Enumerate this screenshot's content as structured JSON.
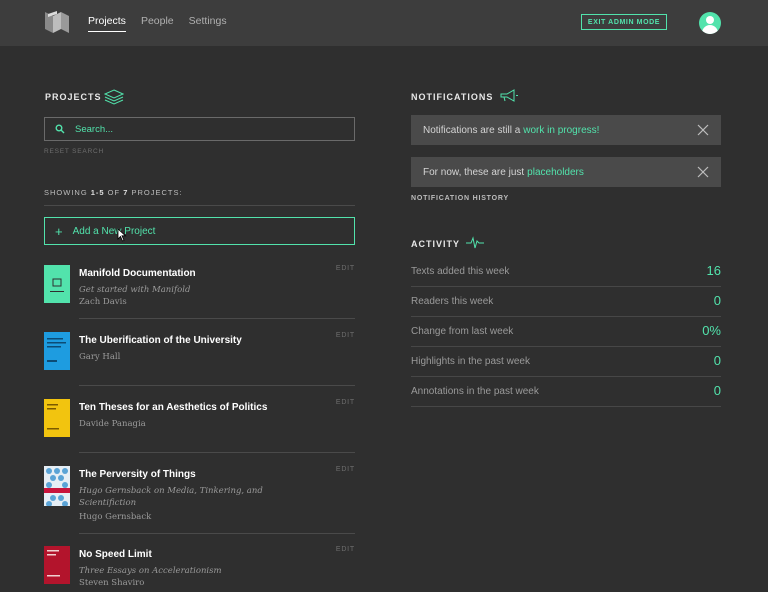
{
  "nav": {
    "items": [
      {
        "label": "Projects",
        "active": true
      },
      {
        "label": "People"
      },
      {
        "label": "Settings"
      }
    ]
  },
  "header": {
    "exit_label": "EXIT ADMIN MODE",
    "avatar_icon": "user-avatar-icon",
    "accent": "#52e3ac"
  },
  "projects": {
    "heading": "PROJECTS",
    "search_placeholder": "Search...",
    "reset_label": "RESET SEARCH",
    "showing_prefix": "SHOWING ",
    "showing_range": "1-5",
    "showing_of": " OF ",
    "showing_total": "7",
    "showing_suffix": " PROJECTS:",
    "add_label": "Add a New Project",
    "edit_label": "EDIT",
    "items": [
      {
        "title": "Manifold Documentation",
        "subtitle": "Get started with Manifold",
        "author": "Zach Davis",
        "cover_color": "#52e3ac"
      },
      {
        "title": "The Uberification of the University",
        "subtitle": "",
        "author": "Gary Hall",
        "cover_color": "#1e9ce0"
      },
      {
        "title": "Ten Theses for an Aesthetics of Politics",
        "subtitle": "",
        "author": "Davide Panagia",
        "cover_color": "#f2c40f"
      },
      {
        "title": "The Perversity of Things",
        "subtitle": "Hugo Gernsback on Media, Tinkering, and Scientifiction",
        "author": "Hugo Gernsback",
        "cover_color": "#e6eef5"
      },
      {
        "title": "No Speed Limit",
        "subtitle": "Three Essays on Accelerationism",
        "author": "Steven Shaviro",
        "cover_color": "#b3142c"
      }
    ]
  },
  "notifications": {
    "heading": "NOTIFICATIONS",
    "items": [
      {
        "text": "Notifications are still a",
        "highlight": "work in progress!"
      },
      {
        "text": "For now, these are just",
        "highlight": "placeholders"
      }
    ],
    "history_label": "NOTIFICATION HISTORY"
  },
  "activity": {
    "heading": "ACTIVITY",
    "rows": [
      {
        "label": "Texts added this week",
        "value": "16"
      },
      {
        "label": "Readers this week",
        "value": "0"
      },
      {
        "label": "Change from last week",
        "value": "0%"
      },
      {
        "label": "Highlights in the past week",
        "value": "0"
      },
      {
        "label": "Annotations in the past week",
        "value": "0"
      }
    ]
  }
}
